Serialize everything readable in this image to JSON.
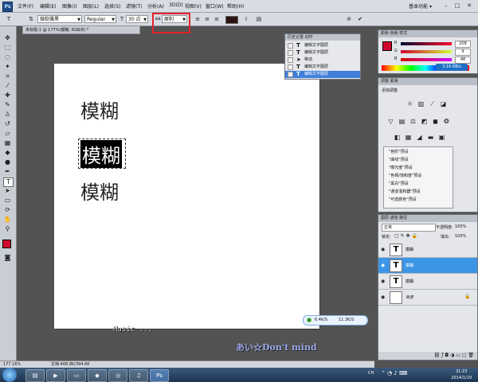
{
  "menubar": {
    "logo": "Ps",
    "items": [
      "文件(F)",
      "编辑(E)",
      "图像(I)",
      "图层(L)",
      "选择(S)",
      "滤镜(T)",
      "分析(A)",
      "3D(D)",
      "视图(V)",
      "窗口(W)",
      "帮助(H)"
    ],
    "workspace": "基本功能 ▾"
  },
  "options": {
    "font_family": "微软雅黑",
    "font_style": "Regular",
    "font_size": "30 点",
    "antialias": "犀利"
  },
  "document_tab": "未标题-1 @ 177%(模糊, RGB/8) *",
  "canvas": {
    "texts": [
      "模糊",
      "模糊",
      "模糊"
    ]
  },
  "history": {
    "tabs": "历史记录  动作",
    "items": [
      "编辑文字图层",
      "编辑文字图层",
      "移动",
      "编辑文字图层",
      "编辑文字图层"
    ]
  },
  "color_panel": {
    "tabs": "颜色  色板  样式",
    "r": "208",
    "g": "9",
    "b": "48",
    "net_speed": "3.16 KB/s"
  },
  "adjust_panel": {
    "tabs": "调整  蒙版",
    "title": "添加调整",
    "presets": [
      "\"色阶\"预设",
      "\"曲线\"预设",
      "\"曝光度\"预设",
      "\"色相/饱和度\"预设",
      "\"黑白\"预设",
      "\"通道混和器\"预设",
      "\"可选颜色\"预设"
    ]
  },
  "layers_panel": {
    "tabs": "图层  通道  路径",
    "blend": "正常",
    "opacity_label": "不透明度:",
    "opacity": "100%",
    "lock_label": "锁定:",
    "fill_label": "填充:",
    "fill": "100%",
    "layers": [
      {
        "name": "模糊",
        "icon": "T"
      },
      {
        "name": "模糊",
        "icon": "T"
      },
      {
        "name": "模糊",
        "icon": "T"
      },
      {
        "name": "背景",
        "icon": ""
      }
    ]
  },
  "statusbar": {
    "zoom": "177.16%",
    "doc": "文档:468.8K/394.6K"
  },
  "speed_widget": {
    "down": "6.4K/S",
    "up": "11.3K/S"
  },
  "overlay": {
    "music": "Music ...",
    "signature": "あい☆Don't mind"
  },
  "taskbar": {
    "time": "21:23",
    "date": "2014/1/19",
    "lang": "CH"
  }
}
